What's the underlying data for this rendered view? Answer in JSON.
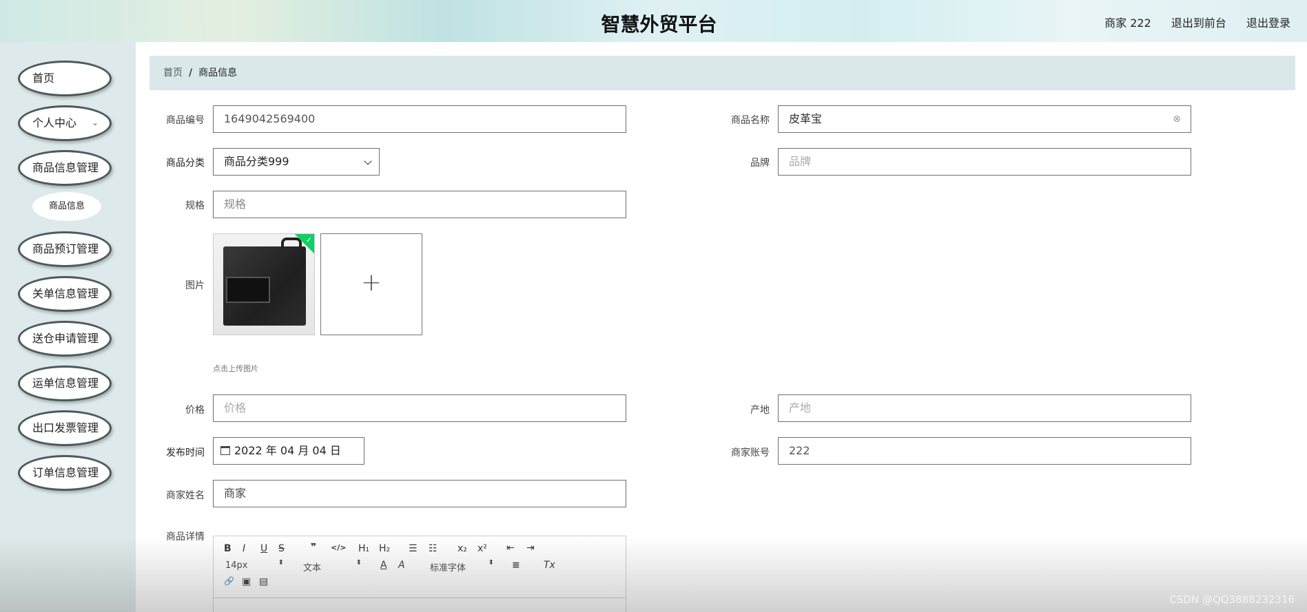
{
  "header": {
    "title": "智慧外贸平台",
    "user": "商家 222",
    "back_to_front": "退出到前台",
    "logout": "退出登录"
  },
  "sidebar": {
    "items": [
      {
        "label": "首页"
      },
      {
        "label": "个人中心",
        "chevron": "⌄"
      },
      {
        "label": "商品信息管理"
      },
      {
        "label": "商品预订管理"
      },
      {
        "label": "关单信息管理"
      },
      {
        "label": "送仓申请管理"
      },
      {
        "label": "运单信息管理"
      },
      {
        "label": "出口发票管理"
      },
      {
        "label": "订单信息管理"
      }
    ],
    "sub_item": "商品信息"
  },
  "breadcrumb": {
    "home": "首页",
    "separator": "/",
    "current": "商品信息"
  },
  "form": {
    "code_label": "商品编号",
    "code_value": "1649042569400",
    "name_label": "商品名称",
    "name_value": "皮革宝",
    "category_label": "商品分类",
    "category_value": "商品分类999",
    "brand_label": "品牌",
    "brand_placeholder": "品牌",
    "spec_label": "规格",
    "spec_placeholder": "规格",
    "image_label": "图片",
    "upload_hint": "点击上传图片",
    "price_label": "价格",
    "price_placeholder": "价格",
    "origin_label": "产地",
    "origin_placeholder": "产地",
    "date_label": "发布时间",
    "date_value": "2022 年 04 月 04 日",
    "account_label": "商家账号",
    "account_value": "222",
    "merchant_name_label": "商家姓名",
    "merchant_name_value": "商家",
    "detail_label": "商品详情"
  },
  "editor": {
    "bold": "B",
    "italic": "I",
    "underline": "U",
    "strike": "S",
    "quote": "❞",
    "code": "</>",
    "h1": "H₁",
    "h2": "H₂",
    "ordered_list": "☰",
    "bullet_list": "☷",
    "subscript": "x₂",
    "superscript": "x²",
    "outdent": "⇤",
    "indent": "⇥",
    "size": "14px",
    "format": "文本",
    "color": "A",
    "background": "A",
    "font": "标准字体",
    "align": "≡",
    "clean": "Tx",
    "link": "🔗",
    "image": "▣",
    "video": "▤"
  },
  "watermark": "CSDN @QQ3888232316",
  "colors": {
    "sidebar_bg": "#dde9ea",
    "breadcrumb_bg": "#dae8ea",
    "upload_success": "#13ce66"
  }
}
